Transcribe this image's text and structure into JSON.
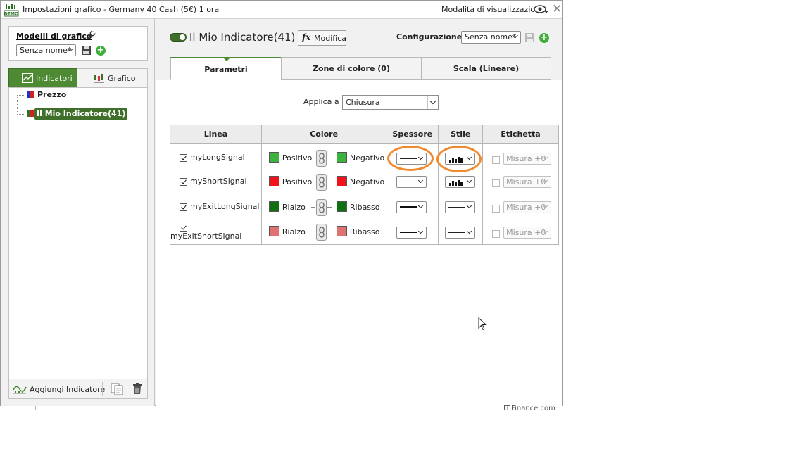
{
  "window": {
    "title": "Impostazioni grafico - Germany 40 Cash (5€) 1 ora",
    "view_mode": "Modalità di visualizzazione",
    "demo_badge": "DEMO"
  },
  "sidebar": {
    "models_title": "Modelli di grafico",
    "model_select": "Senza nome*",
    "tabs": [
      {
        "label": "Indicatori",
        "active": true
      },
      {
        "label": "Grafico",
        "active": false
      }
    ],
    "tree": {
      "price": "Prezzo",
      "indicator": "Il Mio Indicatore(41)"
    },
    "add_indicator": "Aggiungi Indicatore"
  },
  "header": {
    "indicator_title": "Il Mio Indicatore(41)",
    "edit_button": "Modifica",
    "edit_icon_text": "fx",
    "config_label": "Configurazione:",
    "config_select": "Senza nome*"
  },
  "tabs": [
    {
      "label": "Parametri",
      "active": true
    },
    {
      "label": "Zone di colore (0)",
      "active": false
    },
    {
      "label": "Scala (Lineare)",
      "active": false
    }
  ],
  "params": {
    "apply_label": "Applica a",
    "apply_value": "Chiusura"
  },
  "table": {
    "headers": [
      "Linea",
      "Colore",
      "Spessore",
      "Stile",
      "Etichetta"
    ],
    "rows": [
      {
        "checked": true,
        "name": "myLongSignal",
        "color1": "#3cb33c",
        "label1": "Positivo",
        "color2": "#3cb33c",
        "label2": "Negativo",
        "thickness": "thin",
        "style": "histogram",
        "label_value": "Misura +0"
      },
      {
        "checked": true,
        "name": "myShortSignal",
        "color1": "#f0141a",
        "label1": "Positivo",
        "color2": "#f0141a",
        "label2": "Negativo",
        "thickness": "thin",
        "style": "histogram",
        "label_value": "Misura +0"
      },
      {
        "checked": true,
        "name": "myExitLongSignal",
        "color1": "#107010",
        "label1": "Rialzo",
        "color2": "#107010",
        "label2": "Ribasso",
        "thickness": "thick",
        "style": "line",
        "label_value": "Misura +0"
      },
      {
        "checked": true,
        "name": "myExitShortSignal",
        "color1": "#e07272",
        "label1": "Rialzo",
        "color2": "#e07272",
        "label2": "Ribasso",
        "thickness": "thick",
        "style": "line",
        "label_value": "Misura +0"
      }
    ]
  },
  "colors": {
    "accent_green": "#4e8a33",
    "highlight_orange": "#f08a2e"
  },
  "background_text": "IT.Finance.com"
}
